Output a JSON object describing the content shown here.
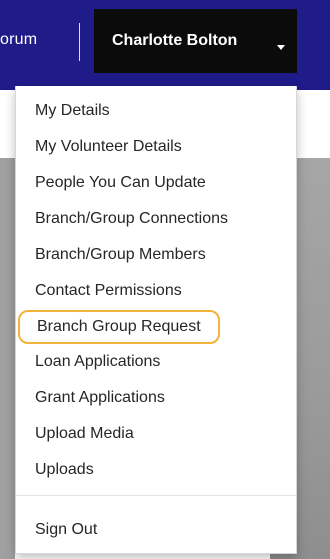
{
  "navbar": {
    "forum_label": "orum",
    "user_name": "Charlotte Bolton",
    "bar_color": "#1f1c8a",
    "user_bg_color": "#0b0b0b"
  },
  "dropdown": {
    "highlight_color": "#f1b43a",
    "items": [
      {
        "label": "My Details"
      },
      {
        "label": "My Volunteer Details"
      },
      {
        "label": "People You Can Update"
      },
      {
        "label": "Branch/Group Connections"
      },
      {
        "label": "Branch/Group Members"
      },
      {
        "label": "Contact Permissions"
      },
      {
        "label": "Branch Group Request"
      },
      {
        "label": "Loan Applications"
      },
      {
        "label": "Grant Applications"
      },
      {
        "label": "Upload Media"
      },
      {
        "label": "Uploads"
      }
    ],
    "sign_out_label": "Sign Out"
  }
}
